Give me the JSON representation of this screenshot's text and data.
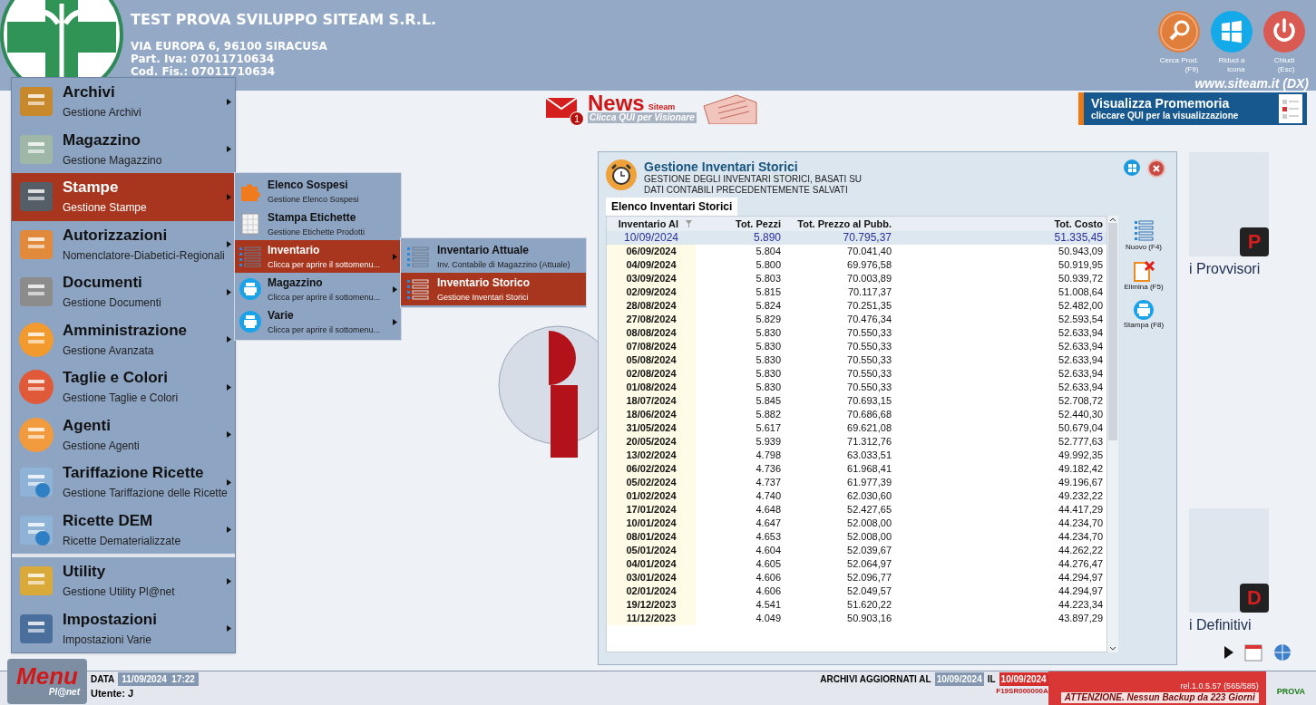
{
  "header": {
    "company": "TEST PROVA SVILUPPO SITEAM S.R.L.",
    "address": "VIA EUROPA 6, 96100 SIRACUSA",
    "vat": "Part. Iva: 07011710634",
    "tax_code": "Cod. Fis.: 07011710634",
    "website": "www.siteam.it (DX)",
    "buttons": [
      {
        "kind": "search",
        "label_1": "Cerca Prod.",
        "label_2": "(F9)"
      },
      {
        "kind": "minimize",
        "label_1": "Riduci a",
        "label_2": "icona"
      },
      {
        "kind": "close",
        "label_1": "Chiudi",
        "label_2": "(Esc)"
      }
    ]
  },
  "news": {
    "badge": "1",
    "title": "News",
    "brand": "Siteam",
    "subtitle": "Clicca QUI per Visionare"
  },
  "reminder": {
    "title": "Visualizza Promemoria",
    "subtitle": "cliccare QUI per la visualizzazione"
  },
  "desktop_tiles": [
    {
      "label": "i Provvisori",
      "letter": "P"
    },
    {
      "label": "i Definitivi",
      "letter": "D"
    }
  ],
  "main_menu": [
    {
      "title": "Archivi",
      "subtitle": "Gestione Archivi",
      "selected": false
    },
    {
      "title": "Magazzino",
      "subtitle": "Gestione Magazzino",
      "selected": false
    },
    {
      "title": "Stampe",
      "subtitle": "Gestione Stampe",
      "selected": true
    },
    {
      "title": "Autorizzazioni",
      "subtitle": "Nomenclatore-Diabetici-Regionali",
      "selected": false
    },
    {
      "title": "Documenti",
      "subtitle": "Gestione Documenti",
      "selected": false
    },
    {
      "title": "Amministrazione",
      "subtitle": "Gestione Avanzata",
      "selected": false
    },
    {
      "title": "Taglie e Colori",
      "subtitle": "Gestione Taglie e Colori",
      "selected": false
    },
    {
      "title": "Agenti",
      "subtitle": "Gestione Agenti",
      "selected": false
    },
    {
      "title": "Tariffazione Ricette",
      "subtitle": "Gestione Tariffazione delle Ricette",
      "selected": false
    },
    {
      "title": "Ricette DEM",
      "subtitle": "Ricette Dematerializzate",
      "selected": false
    },
    {
      "title": "Utility",
      "subtitle": "Gestione Utility Pl@net",
      "selected": false
    },
    {
      "title": "Impostazioni",
      "subtitle": "Impostazioni Varie",
      "selected": false
    }
  ],
  "submenu": [
    {
      "title": "Elenco Sospesi",
      "subtitle": "Gestione Elenco Sospesi",
      "selected": false,
      "has_submenu": false
    },
    {
      "title": "Stampa Etichette",
      "subtitle": "Gestione Etichette Prodotti",
      "selected": false,
      "has_submenu": false
    },
    {
      "title": "Inventario",
      "subtitle": "Clicca per aprire il sottomenu...",
      "selected": true,
      "has_submenu": true
    },
    {
      "title": "Magazzino",
      "subtitle": "Clicca per aprire il sottomenu...",
      "selected": false,
      "has_submenu": true
    },
    {
      "title": "Varie",
      "subtitle": "Clicca per aprire il sottomenu...",
      "selected": false,
      "has_submenu": true
    }
  ],
  "submenu_2": [
    {
      "title": "Inventario Attuale",
      "subtitle": "Inv. Contabile di Magazzino (Attuale)",
      "selected": false
    },
    {
      "title": "Inventario Storico",
      "subtitle": "Gestione Inventari Storici",
      "selected": true
    }
  ],
  "dialog": {
    "title": "Gestione Inventari Storici",
    "description_1": "GESTIONE DEGLI INVENTARI STORICI, BASATI SU",
    "description_2": "DATI CONTABILI PRECEDENTEMENTE SALVATI",
    "tab": "Elenco Inventari Storici",
    "table": {
      "columns": [
        "Inventario Al",
        "Tot. Pezzi",
        "Tot. Prezzo al Pubb.",
        "Tot. Costo"
      ],
      "rows": [
        {
          "cells": [
            "10/09/2024",
            "5.890",
            "70.795,37",
            "51.335,45"
          ],
          "selected": true
        },
        {
          "cells": [
            "06/09/2024",
            "5.804",
            "70.041,40",
            "50.943,09"
          ],
          "selected": false
        },
        {
          "cells": [
            "04/09/2024",
            "5.800",
            "69.976,58",
            "50.919,95"
          ],
          "selected": false
        },
        {
          "cells": [
            "03/09/2024",
            "5.803",
            "70.003,89",
            "50.939,72"
          ],
          "selected": false
        },
        {
          "cells": [
            "02/09/2024",
            "5.815",
            "70.117,37",
            "51.008,64"
          ],
          "selected": false
        },
        {
          "cells": [
            "28/08/2024",
            "5.824",
            "70.251,35",
            "52.482,00"
          ],
          "selected": false
        },
        {
          "cells": [
            "27/08/2024",
            "5.829",
            "70.476,34",
            "52.593,54"
          ],
          "selected": false
        },
        {
          "cells": [
            "08/08/2024",
            "5.830",
            "70.550,33",
            "52.633,94"
          ],
          "selected": false
        },
        {
          "cells": [
            "07/08/2024",
            "5.830",
            "70.550,33",
            "52.633,94"
          ],
          "selected": false
        },
        {
          "cells": [
            "05/08/2024",
            "5.830",
            "70.550,33",
            "52.633,94"
          ],
          "selected": false
        },
        {
          "cells": [
            "02/08/2024",
            "5.830",
            "70.550,33",
            "52.633,94"
          ],
          "selected": false
        },
        {
          "cells": [
            "01/08/2024",
            "5.830",
            "70.550,33",
            "52.633,94"
          ],
          "selected": false
        },
        {
          "cells": [
            "18/07/2024",
            "5.845",
            "70.693,15",
            "52.708,72"
          ],
          "selected": false
        },
        {
          "cells": [
            "18/06/2024",
            "5.882",
            "70.686,68",
            "52.440,30"
          ],
          "selected": false
        },
        {
          "cells": [
            "31/05/2024",
            "5.617",
            "69.621,08",
            "50.679,04"
          ],
          "selected": false
        },
        {
          "cells": [
            "20/05/2024",
            "5.939",
            "71.312,76",
            "52.777,63"
          ],
          "selected": false
        },
        {
          "cells": [
            "13/02/2024",
            "4.798",
            "63.033,51",
            "49.992,35"
          ],
          "selected": false
        },
        {
          "cells": [
            "06/02/2024",
            "4.736",
            "61.968,41",
            "49.182,42"
          ],
          "selected": false
        },
        {
          "cells": [
            "05/02/2024",
            "4.737",
            "61.977,39",
            "49.196,67"
          ],
          "selected": false
        },
        {
          "cells": [
            "01/02/2024",
            "4.740",
            "62.030,60",
            "49.232,22"
          ],
          "selected": false
        },
        {
          "cells": [
            "17/01/2024",
            "4.648",
            "52.427,65",
            "44.417,29"
          ],
          "selected": false
        },
        {
          "cells": [
            "10/01/2024",
            "4.647",
            "52.008,00",
            "44.234,70"
          ],
          "selected": false
        },
        {
          "cells": [
            "08/01/2024",
            "4.653",
            "52.008,00",
            "44.234,70"
          ],
          "selected": false
        },
        {
          "cells": [
            "05/01/2024",
            "4.604",
            "52.039,67",
            "44.262,22"
          ],
          "selected": false
        },
        {
          "cells": [
            "04/01/2024",
            "4.605",
            "52.064,97",
            "44.276,47"
          ],
          "selected": false
        },
        {
          "cells": [
            "03/01/2024",
            "4.606",
            "52.096,77",
            "44.294,97"
          ],
          "selected": false
        },
        {
          "cells": [
            "02/01/2024",
            "4.606",
            "52.049,57",
            "44.294,97"
          ],
          "selected": false
        },
        {
          "cells": [
            "19/12/2023",
            "4.541",
            "51.620,22",
            "44.223,34"
          ],
          "selected": false
        },
        {
          "cells": [
            "11/12/2023",
            "4.049",
            "50.903,16",
            "43.897,29"
          ],
          "selected": false
        }
      ]
    },
    "actions": [
      {
        "kind": "new",
        "label": "Nuovo (F4)"
      },
      {
        "kind": "delete",
        "label": "Elimina (F5)"
      },
      {
        "kind": "print",
        "label": "Stampa (F8)"
      }
    ]
  },
  "status_bar": {
    "menu_title": "Menu",
    "menu_subtitle": "Pl@net",
    "date_label": "DATA",
    "date_value": "11/09/2024  17:22",
    "user": "Utente: J",
    "archives_label": "ARCHIVI AGGIORNATI AL",
    "archives_date": "10/09/2024",
    "archives_il": "IL",
    "archives_il_date": "10/09/2024",
    "serial": "F19SR000000A",
    "version": "rel.1.0.5.57 (565/585)",
    "mode": "PROVA",
    "warning": "ATTENZIONE. Nessun Backup da 223 Giorni"
  }
}
